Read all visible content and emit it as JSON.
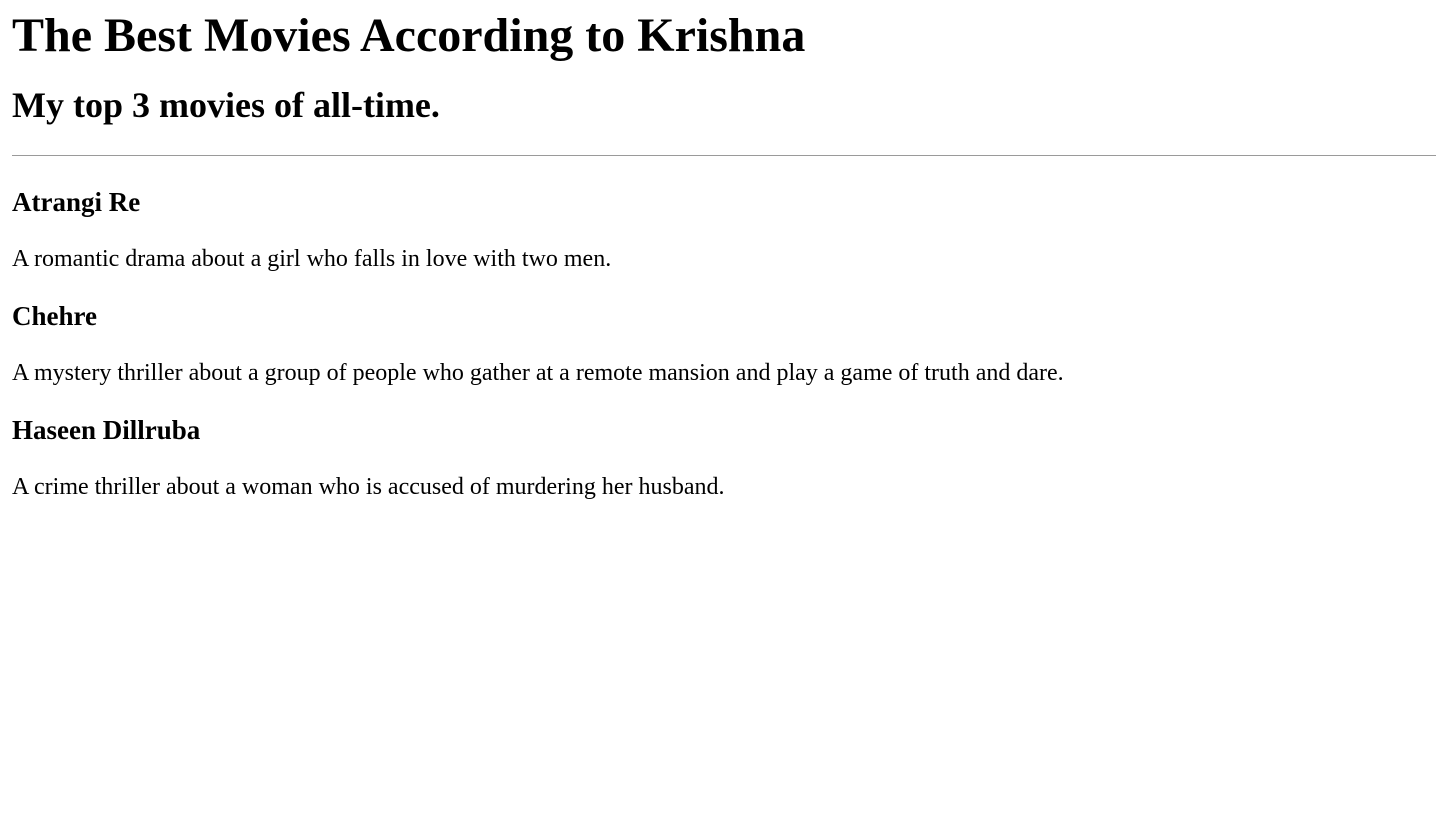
{
  "header": {
    "title": "The Best Movies According to Krishna",
    "subtitle": "My top 3 movies of all-time."
  },
  "movies": [
    {
      "title": "Atrangi Re",
      "description": "A romantic drama about a girl who falls in love with two men."
    },
    {
      "title": "Chehre",
      "description": "A mystery thriller about a group of people who gather at a remote mansion and play a game of truth and dare."
    },
    {
      "title": "Haseen Dillruba",
      "description": "A crime thriller about a woman who is accused of murdering her husband."
    }
  ]
}
